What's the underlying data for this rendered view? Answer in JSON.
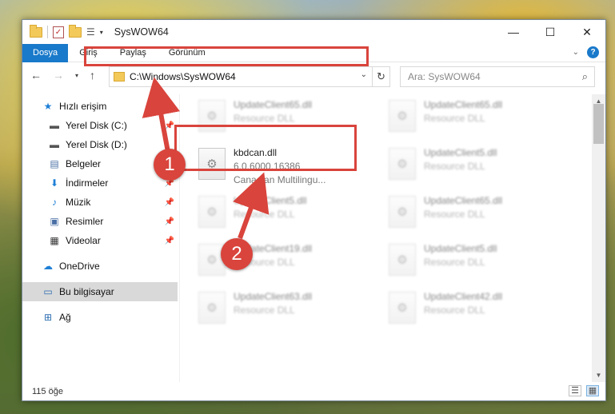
{
  "window": {
    "title": "SysWOW64",
    "controls": {
      "minimize": "—",
      "maximize": "☐",
      "close": "✕"
    }
  },
  "ribbon": {
    "tabs": [
      "Dosya",
      "Giriş",
      "Paylaş",
      "Görünüm"
    ],
    "active_tab": "Dosya",
    "help": "?"
  },
  "address": {
    "path": "C:\\Windows\\SysWOW64",
    "search_placeholder": "Ara: SysWOW64"
  },
  "nav_pane": {
    "items": [
      {
        "label": "Hızlı erişim",
        "icon": "star-icon"
      },
      {
        "label": "Yerel Disk (C:)",
        "icon": "drive-icon",
        "pinned": true
      },
      {
        "label": "Yerel Disk (D:)",
        "icon": "drive-icon"
      },
      {
        "label": "Belgeler",
        "icon": "document-icon",
        "pinned": true
      },
      {
        "label": "İndirmeler",
        "icon": "download-icon",
        "pinned": true
      },
      {
        "label": "Müzik",
        "icon": "music-icon",
        "pinned": true
      },
      {
        "label": "Resimler",
        "icon": "pictures-icon",
        "pinned": true
      },
      {
        "label": "Videolar",
        "icon": "video-icon",
        "pinned": true
      },
      {
        "label": "OneDrive",
        "icon": "cloud-icon"
      },
      {
        "label": "Bu bilgisayar",
        "icon": "computer-icon",
        "selected": true
      },
      {
        "label": "Ağ",
        "icon": "network-icon"
      }
    ]
  },
  "files": {
    "highlighted": {
      "name": "kbdcan.dll",
      "version": "6.0.6000.16386",
      "description": "Canadian Multilingu..."
    },
    "blurred": [
      {
        "name": "UpdateClient65.dll",
        "sub": "Resource DLL"
      },
      {
        "name": "UpdateClient65.dll",
        "sub": "Resource DLL"
      },
      {
        "name": "UpdateClient5.dll",
        "sub": "Resource DLL"
      },
      {
        "name": "UpdateClient5.dll",
        "sub": "Resource DLL"
      },
      {
        "name": "UpdateClient65.dll",
        "sub": "Resource DLL"
      },
      {
        "name": "UpdateClient19.dll",
        "sub": "Resource DLL"
      },
      {
        "name": "UpdateClient5.dll",
        "sub": "Resource DLL"
      },
      {
        "name": "UpdateClient63.dll",
        "sub": "Resource DLL"
      },
      {
        "name": "UpdateClient42.dll",
        "sub": "Resource DLL"
      }
    ]
  },
  "status": {
    "count": "115 öğe"
  },
  "annotations": {
    "badge1": "1",
    "badge2": "2",
    "accent": "#d9443c"
  }
}
